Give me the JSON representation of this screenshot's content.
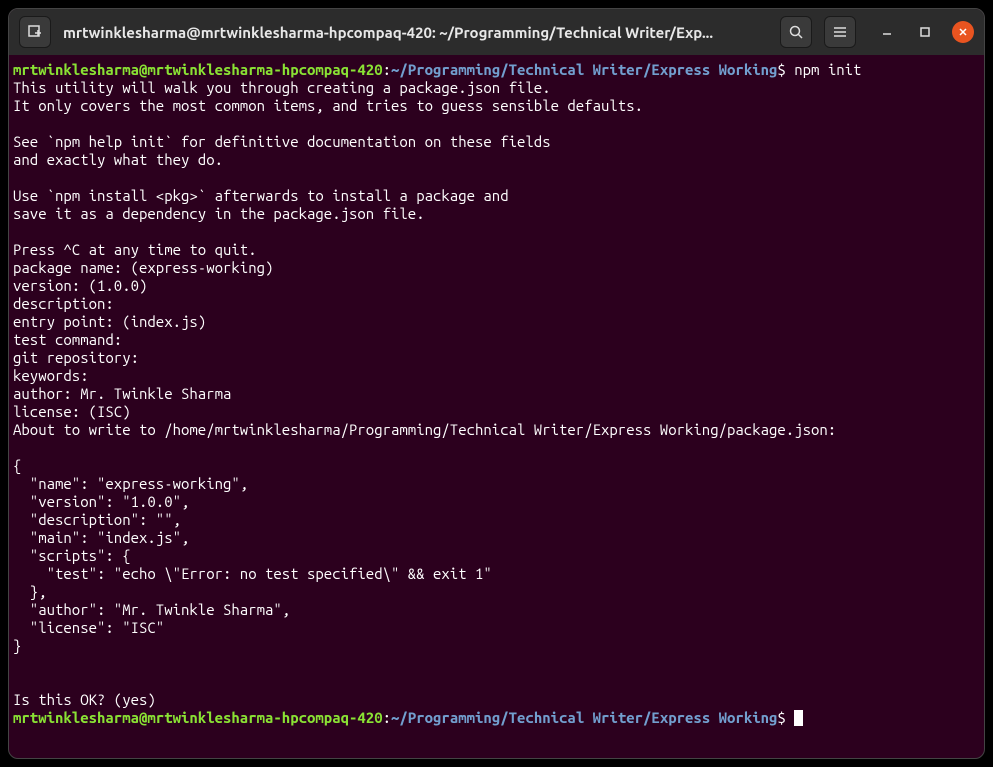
{
  "titlebar": {
    "title": "mrtwinklesharma@mrtwinklesharma-hpcompaq-420: ~/Programming/Technical Writer/Exp..."
  },
  "prompt": {
    "user_host": "mrtwinklesharma@mrtwinklesharma-hpcompaq-420",
    "colon": ":",
    "path": "~/Programming/Technical Writer/Express Working",
    "dollar": "$"
  },
  "command1": "npm init",
  "output_lines": [
    "This utility will walk you through creating a package.json file.",
    "It only covers the most common items, and tries to guess sensible defaults.",
    "",
    "See `npm help init` for definitive documentation on these fields",
    "and exactly what they do.",
    "",
    "Use `npm install <pkg>` afterwards to install a package and",
    "save it as a dependency in the package.json file.",
    "",
    "Press ^C at any time to quit.",
    "package name: (express-working) ",
    "version: (1.0.0) ",
    "description: ",
    "entry point: (index.js) ",
    "test command: ",
    "git repository: ",
    "keywords: ",
    "author: Mr. Twinkle Sharma",
    "license: (ISC) ",
    "About to write to /home/mrtwinklesharma/Programming/Technical Writer/Express Working/package.json:",
    "",
    "{",
    "  \"name\": \"express-working\",",
    "  \"version\": \"1.0.0\",",
    "  \"description\": \"\",",
    "  \"main\": \"index.js\",",
    "  \"scripts\": {",
    "    \"test\": \"echo \\\"Error: no test specified\\\" && exit 1\"",
    "  },",
    "  \"author\": \"Mr. Twinkle Sharma\",",
    "  \"license\": \"ISC\"",
    "}",
    "",
    "",
    "Is this OK? (yes) "
  ]
}
